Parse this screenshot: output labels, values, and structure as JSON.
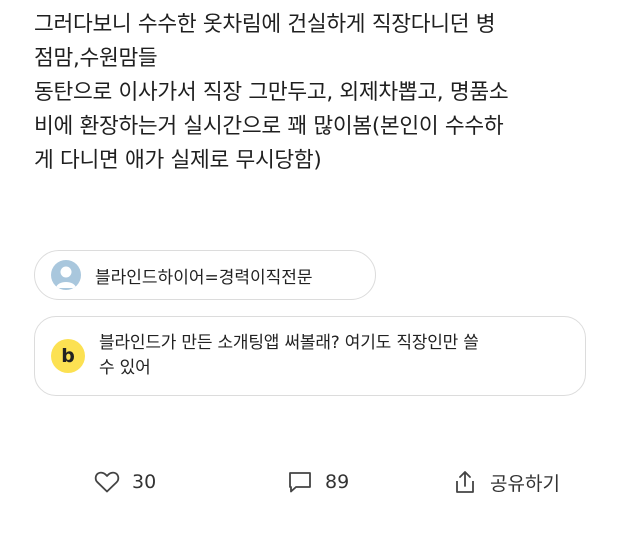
{
  "post": {
    "lines": [
      "그러다보니 수수한 옷차림에 건실하게 직장다니던 병",
      "점맘,수원맘들",
      "동탄으로 이사가서 직장 그만두고, 외제차뽑고, 명품소",
      "비에 환장하는거 실시간으로 꽤 많이봄(본인이 수수하",
      "게 다니면 애가 실제로 무시당함)"
    ]
  },
  "ad_chip": {
    "label": "블라인드하이어=경력이직전문",
    "icon": "user-avatar-icon",
    "color": "#a9c7dd"
  },
  "promo": {
    "logo_letter": "b",
    "logo_color": "#fce152",
    "lines": [
      "블라인드가 만든 소개팅앱 써볼래? 여기도 직장인만 쓸",
      "수 있어"
    ]
  },
  "actions": {
    "likes": "30",
    "comments": "89",
    "share_label": "공유하기"
  }
}
